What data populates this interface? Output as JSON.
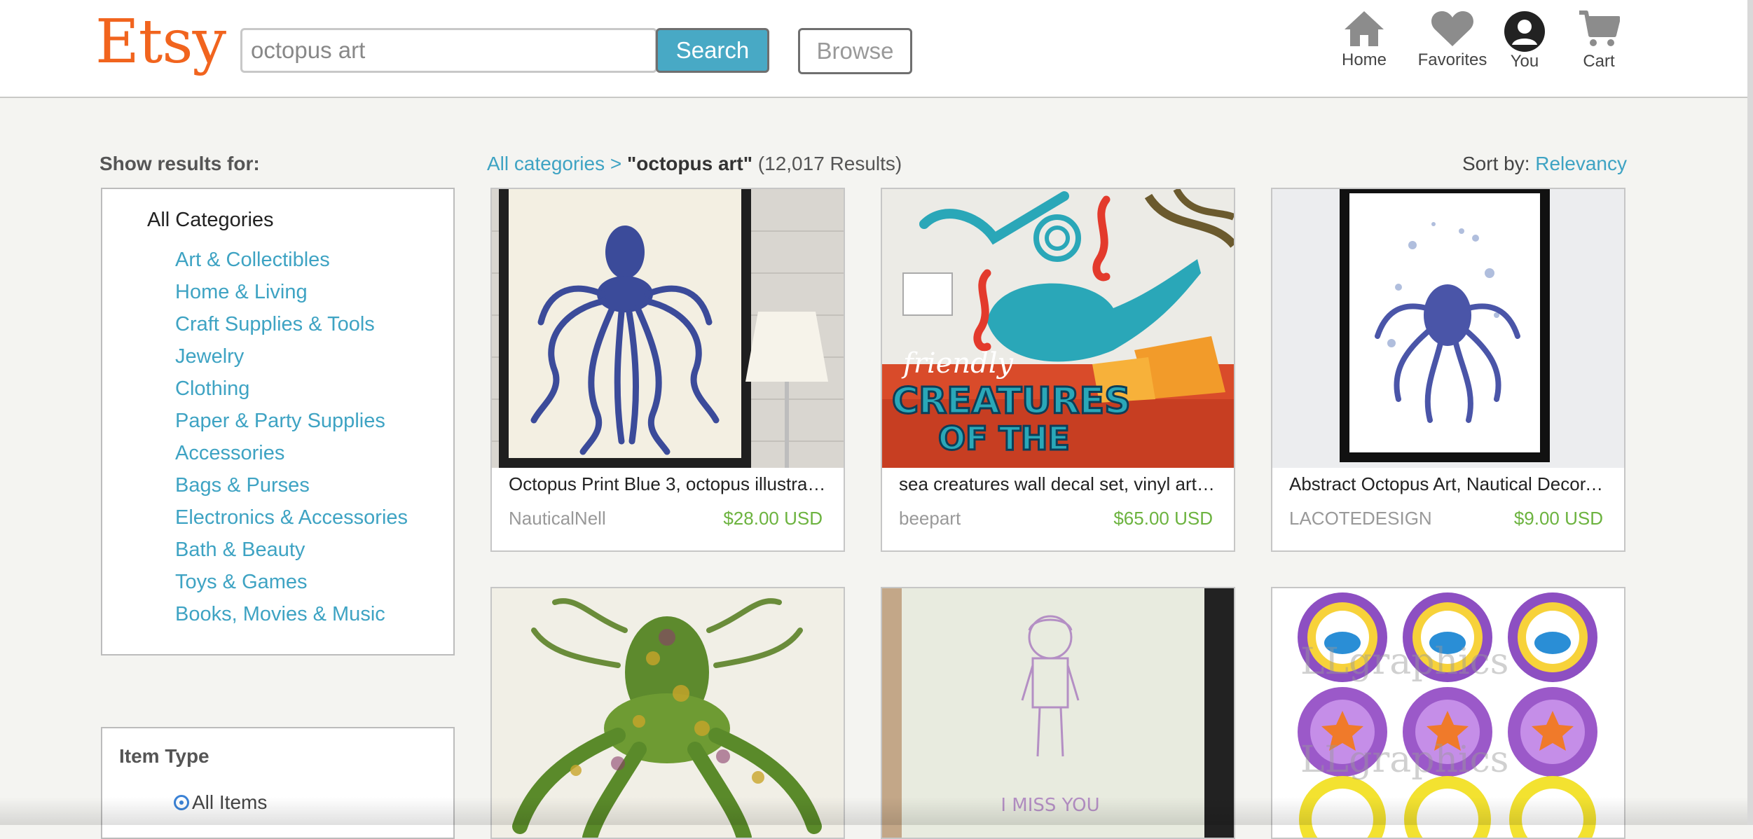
{
  "header": {
    "logo": "Etsy",
    "search_value": "octopus art",
    "search_button": "Search",
    "browse_button": "Browse",
    "nav": [
      {
        "label": "Home",
        "icon": "home-icon"
      },
      {
        "label": "Favorites",
        "icon": "heart-icon"
      },
      {
        "label": "You",
        "icon": "user-icon"
      },
      {
        "label": "Cart",
        "icon": "cart-icon"
      }
    ]
  },
  "sidebar": {
    "heading": "Show results for:",
    "all_categories": "All Categories",
    "categories": [
      "Art & Collectibles",
      "Home & Living",
      "Craft Supplies & Tools",
      "Jewelry",
      "Clothing",
      "Paper & Party Supplies",
      "Accessories",
      "Bags & Purses",
      "Electronics & Accessories",
      "Bath & Beauty",
      "Toys & Games",
      "Books, Movies & Music"
    ],
    "item_type": {
      "title": "Item Type",
      "selected": "All Items"
    }
  },
  "results": {
    "breadcrumb_link": "All categories >",
    "query": "\"octopus art\"",
    "count": "(12,017 Results)",
    "sort_label": "Sort by:",
    "sort_value": "Relevancy",
    "items": [
      {
        "title": "Octopus Print Blue 3, octopus illustrati…",
        "shop": "NauticalNell",
        "price": "$28.00 USD"
      },
      {
        "title": "sea creatures wall decal set, vinyl art, c…",
        "shop": "beepart",
        "price": "$65.00 USD"
      },
      {
        "title": "Abstract Octopus Art, Nautical Decor, …",
        "shop": "LACOTEDESIGN",
        "price": "$9.00 USD"
      },
      {
        "title": "",
        "shop": "",
        "price": ""
      },
      {
        "title": "",
        "shop": "",
        "price": ""
      },
      {
        "title": "",
        "shop": "",
        "price": ""
      }
    ],
    "image_text": {
      "decal_line1": "friendly",
      "decal_line2": "CREATURES",
      "decal_line3": "OF THE",
      "card_text": "I MISS YOU",
      "watermark": "LLgraphics"
    }
  },
  "colors": {
    "brand": "#f1641e",
    "link": "#3ea3c3",
    "price": "#6cb33f",
    "search_button": "#48a9c5"
  }
}
